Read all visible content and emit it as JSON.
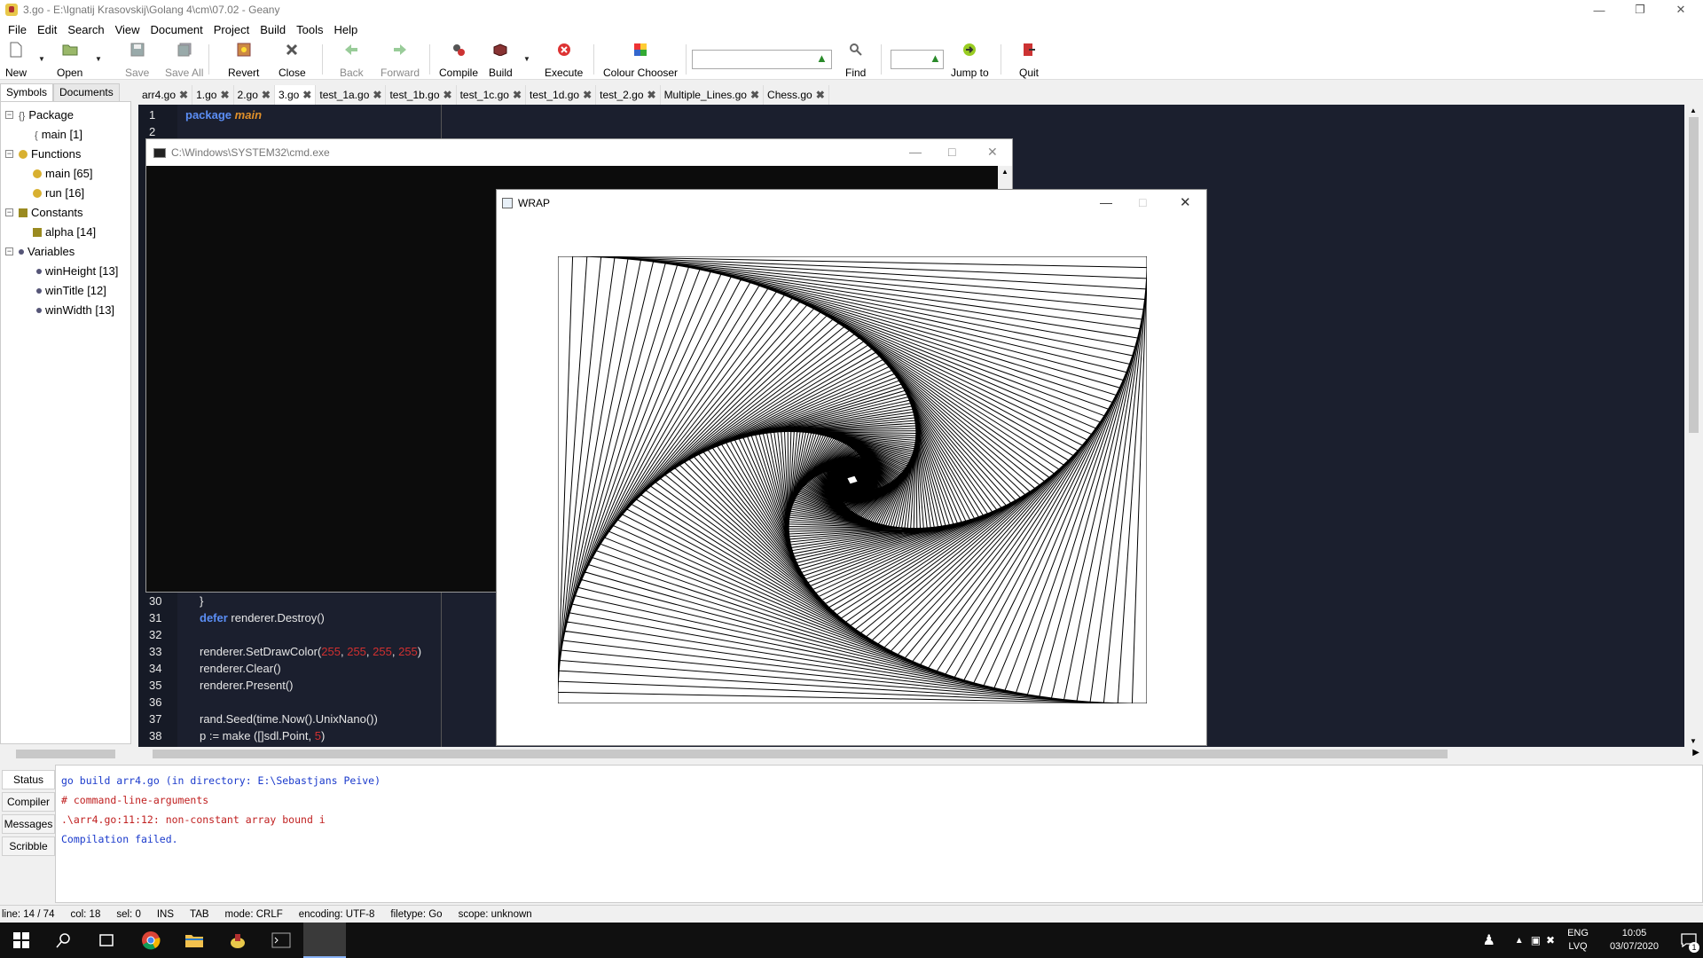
{
  "window": {
    "title": "3.go - E:\\Ignatij Krasovskij\\Golang 4\\cm\\07.02 - Geany"
  },
  "menu": [
    "File",
    "Edit",
    "Search",
    "View",
    "Document",
    "Project",
    "Build",
    "Tools",
    "Help"
  ],
  "toolbar": {
    "new": "New",
    "open": "Open",
    "save": "Save",
    "save_all": "Save All",
    "revert": "Revert",
    "close": "Close",
    "back": "Back",
    "forward": "Forward",
    "compile": "Compile",
    "build": "Build",
    "execute": "Execute",
    "colour_chooser": "Colour Chooser",
    "find": "Find",
    "jump_to": "Jump to",
    "quit": "Quit",
    "search_value": "",
    "line_value": ""
  },
  "sidebar": {
    "tabs": [
      "Symbols",
      "Documents"
    ],
    "tree": [
      {
        "label": "Package",
        "level": 0
      },
      {
        "label": "main [1]",
        "level": 1
      },
      {
        "label": "Functions",
        "level": 0
      },
      {
        "label": "main [65]",
        "level": 1
      },
      {
        "label": "run [16]",
        "level": 1
      },
      {
        "label": "Constants",
        "level": 0
      },
      {
        "label": "alpha [14]",
        "level": 1
      },
      {
        "label": "Variables",
        "level": 0
      },
      {
        "label": "winHeight [13]",
        "level": 1
      },
      {
        "label": "winTitle [12]",
        "level": 1
      },
      {
        "label": "winWidth [13]",
        "level": 1
      }
    ]
  },
  "doc_tabs": [
    "arr4.go",
    "1.go",
    "2.go",
    "3.go",
    "test_1a.go",
    "test_1b.go",
    "test_1c.go",
    "test_1d.go",
    "test_2.go",
    "Multiple_Lines.go",
    "Chess.go"
  ],
  "active_tab": "3.go",
  "editor": {
    "top_lines": [
      {
        "n": "1",
        "kw": "package",
        "rest": "main"
      },
      {
        "n": "2"
      }
    ],
    "bottom_lines": [
      {
        "n": "30",
        "text": "}"
      },
      {
        "n": "31",
        "kw": "defer",
        "text": " renderer.Destroy()"
      },
      {
        "n": "32",
        "text": ""
      },
      {
        "n": "33",
        "text": "renderer.SetDrawColor(",
        "nums": [
          "255",
          "255",
          "255",
          "255"
        ],
        "tail": ")"
      },
      {
        "n": "34",
        "text": "renderer.Clear()"
      },
      {
        "n": "35",
        "text": "renderer.Present()"
      },
      {
        "n": "36",
        "text": ""
      },
      {
        "n": "37",
        "text": "rand.Seed(time.Now().UnixNano())"
      },
      {
        "n": "38",
        "text": "p := make ([]sdl.Point, ",
        "num": "5",
        "tail": ")"
      }
    ]
  },
  "cmd_window": {
    "title": "C:\\Windows\\SYSTEM32\\cmd.exe"
  },
  "wrap_window": {
    "title": "WRAP"
  },
  "messages": {
    "tabs": [
      "Status",
      "Compiler",
      "Messages",
      "Scribble"
    ],
    "lines": [
      {
        "text": "go build arr4.go (in directory: E:\\Sebastjans Peive)",
        "color": "#1a3acc"
      },
      {
        "text": "# command-line-arguments",
        "color": "#c02020"
      },
      {
        "text": ".\\arr4.go:11:12: non-constant array bound i",
        "color": "#c02020"
      },
      {
        "text": "Compilation failed.",
        "color": "#1a3acc"
      }
    ]
  },
  "status": {
    "line": "line: 14 / 74",
    "col": "col: 18",
    "sel": "sel: 0",
    "ins": "INS",
    "tab": "TAB",
    "mode": "mode: CRLF",
    "encoding": "encoding: UTF-8",
    "filetype": "filetype: Go",
    "scope": "scope: unknown"
  },
  "taskbar": {
    "lang": "ENG",
    "layout": "LVQ",
    "time": "10:05",
    "date": "03/07/2020",
    "notif": "1"
  }
}
